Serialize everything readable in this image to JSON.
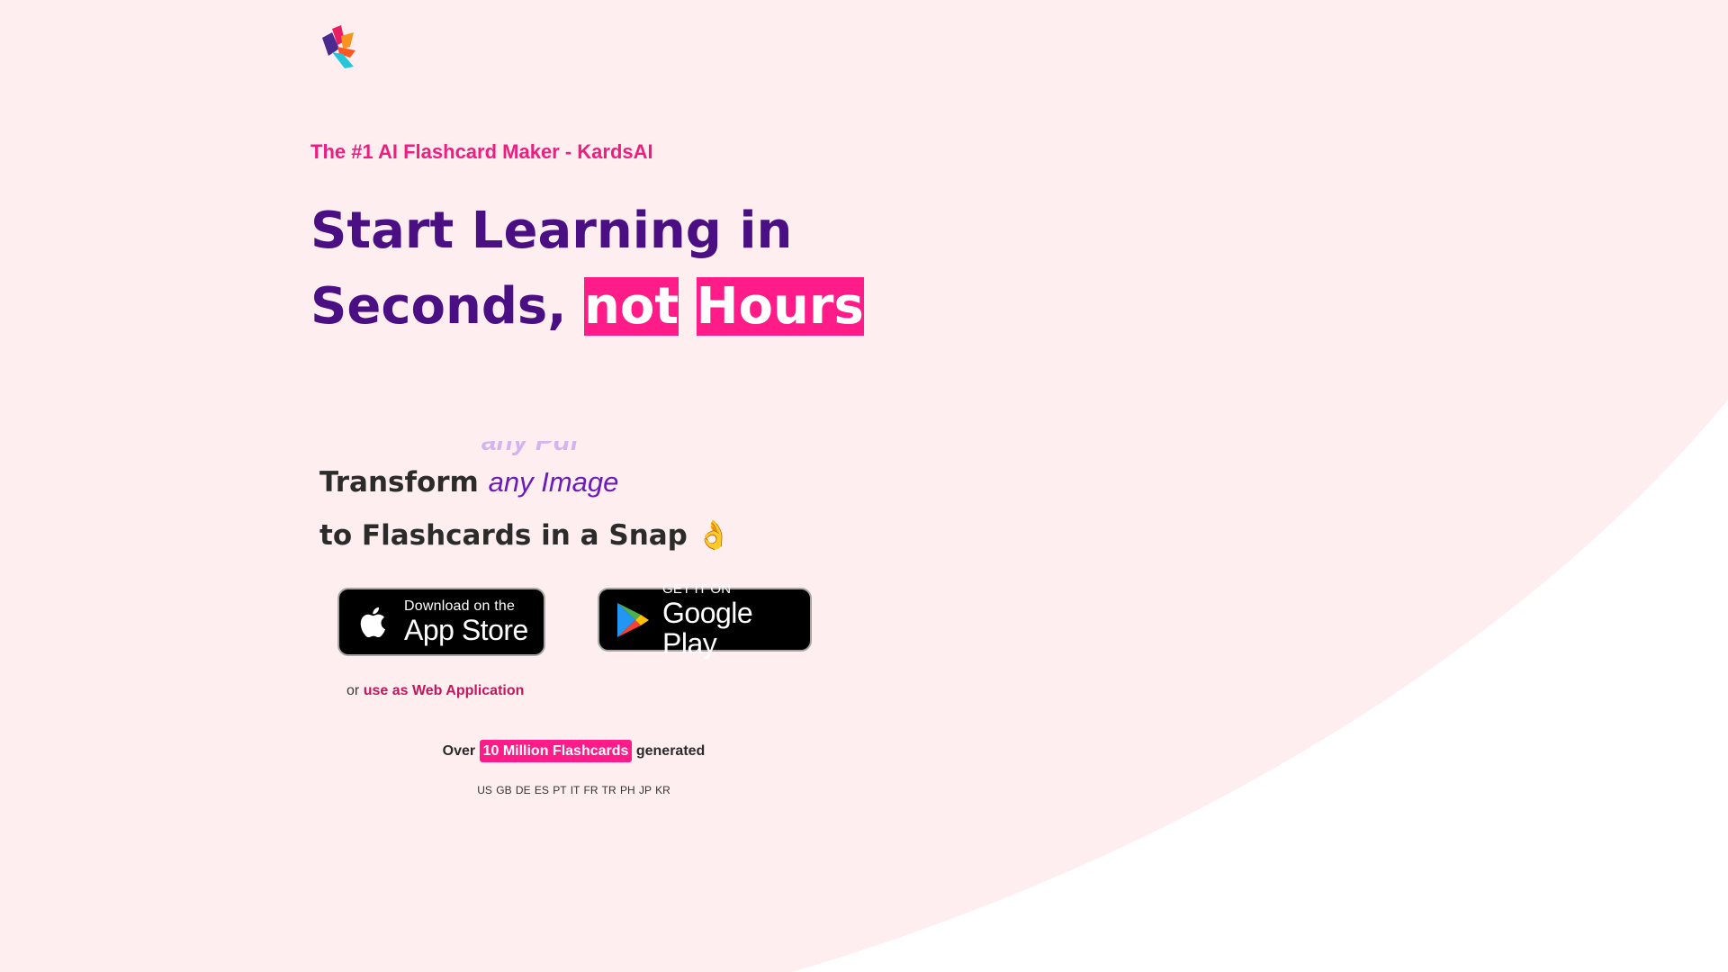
{
  "brand": {
    "logo_icon": "kardsai-logo-icon",
    "colors": {
      "background": "#ffeef0",
      "pink": "#ff1c89",
      "purple": "#4a0f82",
      "accent_purple": "#6a1bb8"
    }
  },
  "hero": {
    "tagline": "The #1 AI Flashcard Maker - KardsAI",
    "headline_part1": "Start Learning in Seconds,",
    "headline_hl1": "not",
    "headline_hl2": "Hours",
    "rotator_prev": "any Pdf",
    "transform_prefix": "Transform",
    "transform_accent": "any Image",
    "snap_text": "to Flashcards in a Snap",
    "snap_emoji": "👌"
  },
  "downloads": {
    "appstore_small": "Download on the",
    "appstore_big": "App Store",
    "googleplay_small": "GET IT ON",
    "googleplay_big": "Google Play"
  },
  "web": {
    "prefix": "or",
    "link": "use as Web Application"
  },
  "stats": {
    "prefix": "Over",
    "highlight": "10 Million Flashcards",
    "suffix": "generated",
    "countries": "US GB DE ES PT IT FR TR PH JP KR"
  }
}
